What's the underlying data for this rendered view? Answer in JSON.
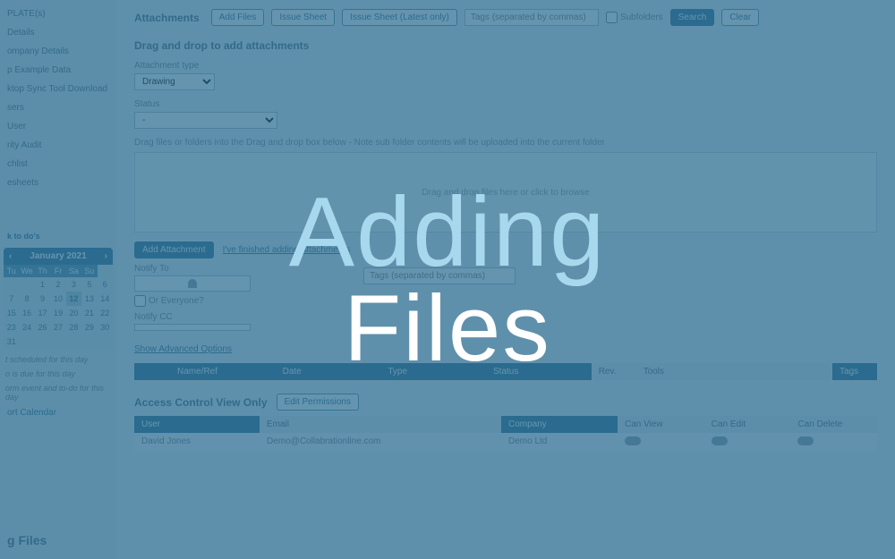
{
  "overlay": {
    "line1": "Adding",
    "line2": "Files"
  },
  "sidebar": {
    "items": [
      "PLATE(s)",
      " Details",
      "ompany Details",
      "p Example Data",
      "ktop Sync Tool Download",
      "sers",
      "User",
      "rity Audit",
      "chlist",
      "esheets"
    ],
    "task_link": "k to do's",
    "legends": [
      "t scheduled for this day",
      "o is due for this day",
      "orm event and to-do for this day"
    ],
    "export": "ort Calendar",
    "footer": "g Files"
  },
  "calendar": {
    "title": "January 2021",
    "nav_l": "‹",
    "nav_r": "›",
    "dow": [
      "Tu",
      "We",
      "Th",
      "Fr",
      "Sa",
      "Su"
    ],
    "weeks": [
      [
        "",
        "",
        "",
        "1",
        "2",
        "3"
      ],
      [
        "5",
        "6",
        "7",
        "8",
        "9",
        "10"
      ],
      [
        "12",
        "13",
        "14",
        "15",
        "16",
        "17"
      ],
      [
        "19",
        "20",
        "21",
        "22",
        "23",
        "24"
      ],
      [
        "26",
        "27",
        "28",
        "29",
        "30",
        "31"
      ]
    ],
    "today": "12"
  },
  "toolbar": {
    "title": "Attachments",
    "add_files": "Add Files",
    "issue_sheet": "Issue Sheet",
    "issue_latest": "Issue Sheet (Latest only)",
    "tags_ph": "Tags (separated by commas)",
    "subfolders": "Subfolders",
    "search": "Search",
    "clear": "Clear"
  },
  "form": {
    "section": "Drag and drop to add attachments",
    "att_type_label": "Attachment type",
    "att_type_value": "Drawing",
    "status_label": "Status",
    "status_value": "-",
    "drop_note": "Drag files or folders into the Drag and drop box below - Note sub folder contents will be uploaded into the current folder",
    "drop_hint": "Drag and drop files here or click to browse",
    "add_attachment": "Add Attachment",
    "finished_link": "I've finished adding attachments",
    "notify_to": "Notify To",
    "or_everyone": "Or Everyone?",
    "notify_cc": "Notify CC",
    "tags2_ph": "Tags (separated by commas)",
    "advanced": "Show Advanced Options"
  },
  "table": {
    "headers": [
      "",
      "Name/Ref",
      "Date",
      "Type",
      "Status",
      "Rev.",
      "Tools",
      "Tags"
    ]
  },
  "acl": {
    "title": "Access Control View Only",
    "edit_perms": "Edit Permissions",
    "headers": {
      "user": "User",
      "email": "Email",
      "company": "Company",
      "view": "Can View",
      "edit": "Can Edit",
      "del": "Can Delete"
    },
    "rows": [
      {
        "user": "David Jones",
        "email": "Demo@Collabrationline.com",
        "company": "Demo Ltd"
      }
    ]
  }
}
